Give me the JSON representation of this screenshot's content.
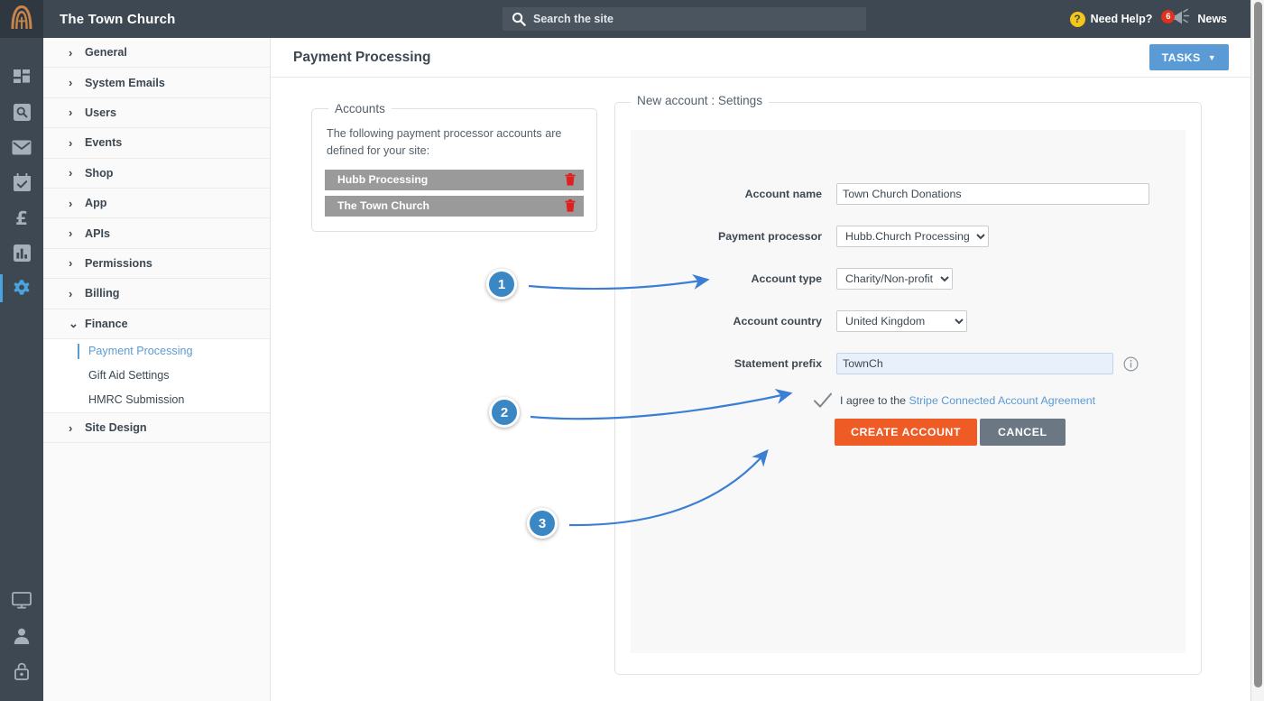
{
  "topbar": {
    "logo_icon": "church-arch-cross-logo",
    "site_title": "The Town Church",
    "search": {
      "icon": "search-icon",
      "placeholder": "Search the site",
      "value": ""
    },
    "help_label": "Need Help?",
    "help_icon": "question-mark-icon",
    "news_label": "News",
    "news_icon": "megaphone-icon",
    "news_badge": "6"
  },
  "rail": {
    "icons": [
      {
        "name": "dashboard-icon",
        "active": false
      },
      {
        "name": "search-box-icon",
        "active": false
      },
      {
        "name": "envelope-icon",
        "active": false
      },
      {
        "name": "calendar-check-icon",
        "active": false
      },
      {
        "name": "pound-sterling-icon",
        "active": false
      },
      {
        "name": "bar-chart-icon",
        "active": false
      },
      {
        "name": "gear-icon",
        "active": true
      }
    ],
    "bottom_icons": [
      {
        "name": "monitor-icon"
      },
      {
        "name": "user-icon"
      },
      {
        "name": "unlock-padlock-icon"
      }
    ]
  },
  "sidebar": {
    "items": [
      {
        "label": "General",
        "expanded": false
      },
      {
        "label": "System Emails",
        "expanded": false
      },
      {
        "label": "Users",
        "expanded": false
      },
      {
        "label": "Events",
        "expanded": false
      },
      {
        "label": "Shop",
        "expanded": false
      },
      {
        "label": "App",
        "expanded": false
      },
      {
        "label": "APIs",
        "expanded": false
      },
      {
        "label": "Permissions",
        "expanded": false
      },
      {
        "label": "Billing",
        "expanded": false
      },
      {
        "label": "Finance",
        "expanded": true
      },
      {
        "label": "Site Design",
        "expanded": false
      }
    ],
    "finance_children": [
      {
        "label": "Payment Processing",
        "active": true
      },
      {
        "label": "Gift Aid Settings",
        "active": false
      },
      {
        "label": "HMRC Submission",
        "active": false
      }
    ],
    "caret_collapsed": "›",
    "caret_expanded": "⌄"
  },
  "page": {
    "title": "Payment Processing",
    "tasks_button": "TASKS",
    "tasks_caret": "▼"
  },
  "accounts_panel": {
    "legend": "Accounts",
    "description": "The following payment processor accounts are defined for your site:",
    "rows": [
      {
        "name": "Hubb Processing",
        "delete_icon": "trash-icon"
      },
      {
        "name": "The Town Church",
        "delete_icon": "trash-icon"
      }
    ]
  },
  "settings_panel": {
    "legend": "New account : Settings",
    "fields": [
      {
        "label": "Account name",
        "type": "text",
        "value": "Town Church Donations"
      },
      {
        "label": "Payment processor",
        "type": "select",
        "value": "Hubb.Church Processing"
      },
      {
        "label": "Account type",
        "type": "select",
        "value": "Charity/Non-profit"
      },
      {
        "label": "Account country",
        "type": "select",
        "value": "United Kingdom"
      },
      {
        "label": "Statement prefix",
        "type": "text",
        "value": "TownCh",
        "info_icon": "info-circle-icon"
      }
    ],
    "agreement": {
      "check_icon": "checkmark-icon",
      "text_prefix": "I agree to the ",
      "link_text": "Stripe Connected Account Agreement"
    },
    "create_button": "CREATE ACCOUNT",
    "cancel_button": "CANCEL"
  },
  "annotations": [
    {
      "number": "1",
      "target": "account-type-field"
    },
    {
      "number": "2",
      "target": "agreement-checkmark"
    },
    {
      "number": "3",
      "target": "create-account-button"
    }
  ],
  "colors": {
    "topbar": "#3d4852",
    "accent_blue": "#5b9bd5",
    "annotation_blue": "#3b87c4",
    "create_orange": "#ef5b25",
    "cancel_gray": "#6b7884",
    "badge_red": "#e0301e",
    "help_yellow": "#f5c518",
    "logo_orange": "#c8854a"
  }
}
